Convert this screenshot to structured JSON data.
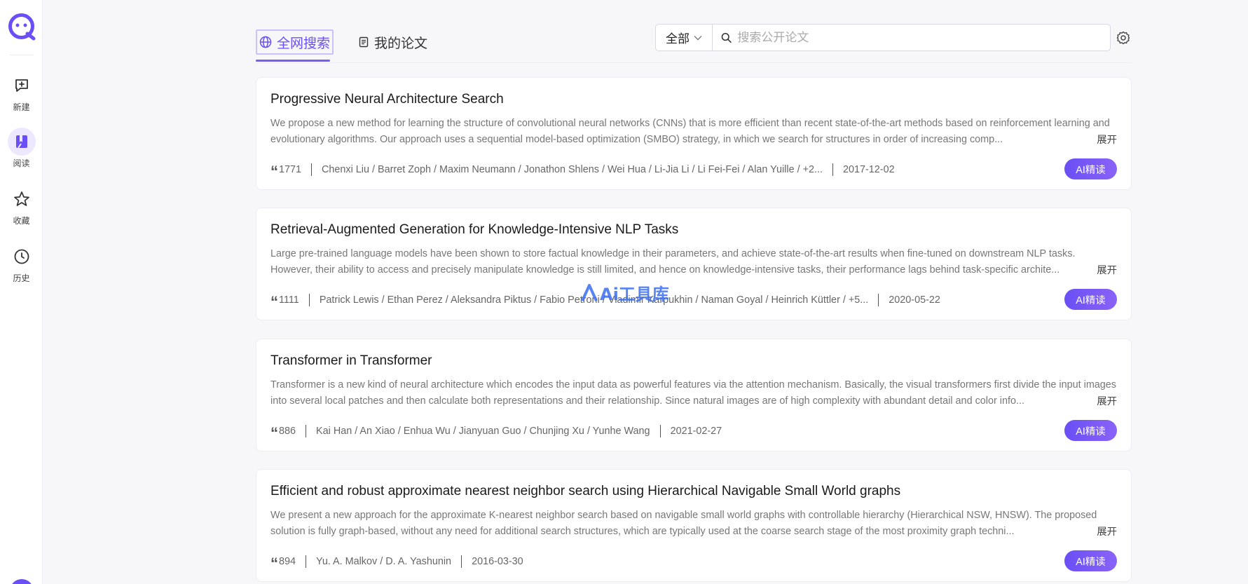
{
  "sidebar": {
    "items": [
      {
        "label": "新建",
        "icon": "new-chat-icon"
      },
      {
        "label": "阅读",
        "icon": "book-icon"
      },
      {
        "label": "收藏",
        "icon": "star-icon"
      },
      {
        "label": "历史",
        "icon": "clock-icon"
      }
    ]
  },
  "tabs": [
    {
      "label": "全网搜索",
      "icon": "globe-icon"
    },
    {
      "label": "我的论文",
      "icon": "document-icon"
    }
  ],
  "search": {
    "scope": "全部",
    "placeholder": "搜索公开论文"
  },
  "papers": [
    {
      "title": "Progressive Neural Architecture Search",
      "abstract": "We propose a new method for learning the structure of convolutional neural networks (CNNs) that is more efficient than recent state-of-the-art methods based on reinforcement learning and evolutionary algorithms. Our approach uses a sequential model-based optimization (SMBO) strategy, in which we search for structures in order of increasing comp...",
      "citations": "1771",
      "authors": "Chenxi Liu / Barret Zoph / Maxim Neumann / Jonathon Shlens / Wei Hua / Li-Jia Li / Li Fei-Fei / Alan Yuille / +2...",
      "date": "2017-12-02"
    },
    {
      "title": "Retrieval-Augmented Generation for Knowledge-Intensive NLP Tasks",
      "abstract": "Large pre-trained language models have been shown to store factual knowledge in their parameters, and achieve state-of-the-art results when fine-tuned on downstream NLP tasks. However, their ability to access and precisely manipulate knowledge is still limited, and hence on knowledge-intensive tasks, their performance lags behind task-specific archite...",
      "citations": "1111",
      "authors": "Patrick Lewis / Ethan Perez / Aleksandra Piktus / Fabio Petroni / Vladimir Karpukhin / Naman Goyal / Heinrich Küttler / +5...",
      "date": "2020-05-22"
    },
    {
      "title": "Transformer in Transformer",
      "abstract": "Transformer is a new kind of neural architecture which encodes the input data as powerful features via the attention mechanism. Basically, the visual transformers first divide the input images into several local patches and then calculate both representations and their relationship. Since natural images are of high complexity with abundant detail and color info...",
      "citations": "886",
      "authors": "Kai Han / An Xiao / Enhua Wu / Jianyuan Guo / Chunjing Xu / Yunhe Wang",
      "date": "2021-02-27"
    },
    {
      "title": "Efficient and robust approximate nearest neighbor search using Hierarchical Navigable Small World graphs",
      "abstract": "We present a new approach for the approximate K-nearest neighbor search based on navigable small world graphs with controllable hierarchy (Hierarchical NSW, HNSW). The proposed solution is fully graph-based, without any need for additional search structures, which are typically used at the coarse search stage of the most proximity graph techni...",
      "citations": "894",
      "authors": "Yu. A. Malkov / D. A. Yashunin",
      "date": "2016-03-30"
    }
  ],
  "labels": {
    "expand": "展开",
    "ai_read": "AI精读"
  },
  "watermark": "Ai工具库",
  "colors": {
    "accent": "#6a4ff5",
    "accent_light": "#ede8ff"
  }
}
